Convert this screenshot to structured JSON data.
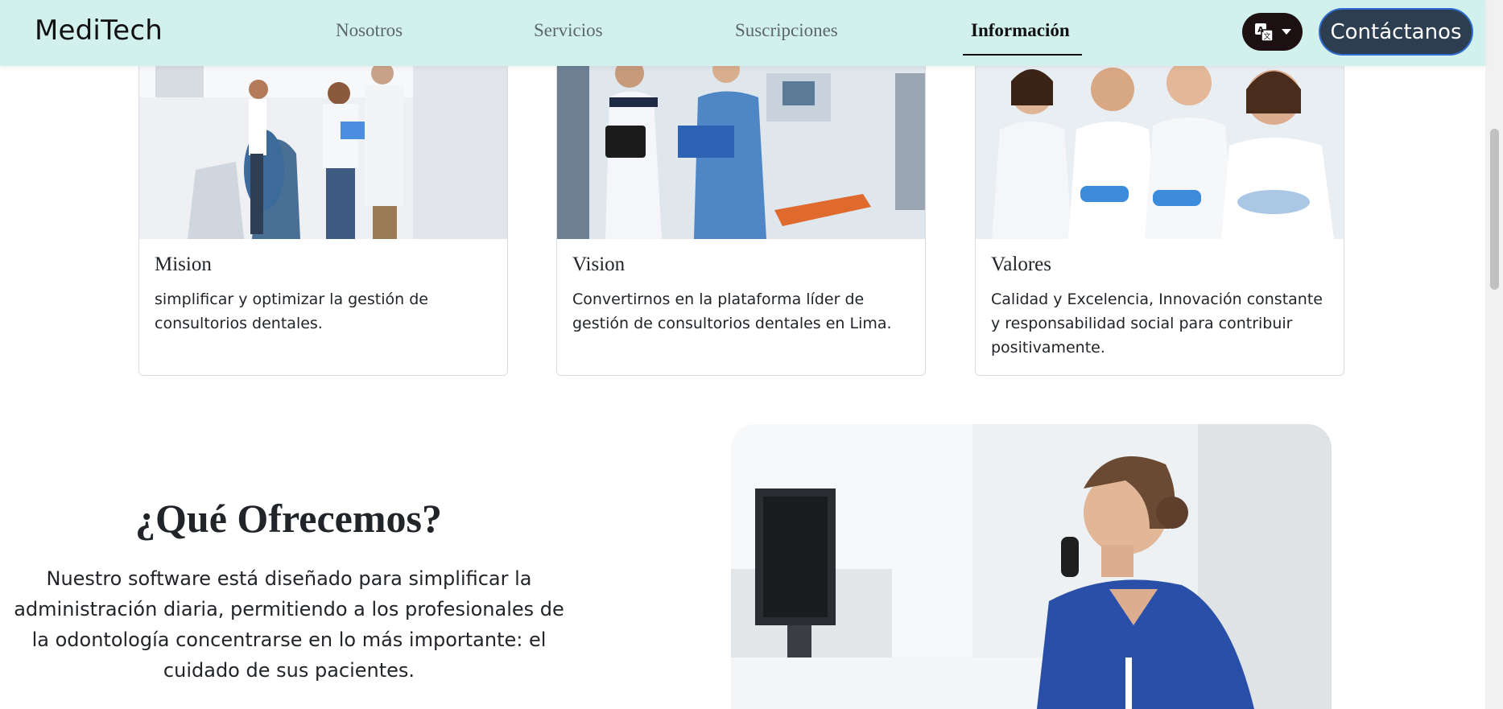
{
  "brand": "MediTech",
  "nav": {
    "links": [
      "Nosotros",
      "Servicios",
      "Suscripciones",
      "Información"
    ],
    "active_index": 3,
    "contact_label": "Contáctanos",
    "language_icon": "translate-icon"
  },
  "cards": [
    {
      "title": "Mision",
      "text": "simplificar y optimizar la gestión de consultorios dentales.",
      "image": "dentists-consulting-photo"
    },
    {
      "title": "Vision",
      "text": "Convertirnos en la plataforma líder de gestión de consultorios dentales en Lima.",
      "image": "nurses-with-tablet-photo"
    },
    {
      "title": "Valores",
      "text": "Calidad y Excelencia, Innovación constante y responsabilidad social para contribuir positivamente.",
      "image": "smiling-dental-team-photo"
    }
  ],
  "offer": {
    "title": "¿Qué Ofrecemos?",
    "text": "Nuestro software está diseñado para simplificar la administración diaria, permitiendo a los profesionales de la odontología concentrarse en lo más importante: el cuidado de sus pacientes.",
    "image": "receptionist-on-phone-photo"
  },
  "colors": {
    "navbar_bg": "#d3f1ec",
    "contact_bg": "#2c3e50",
    "contact_border": "#2f6bd0",
    "lang_bg": "#1c1012"
  }
}
